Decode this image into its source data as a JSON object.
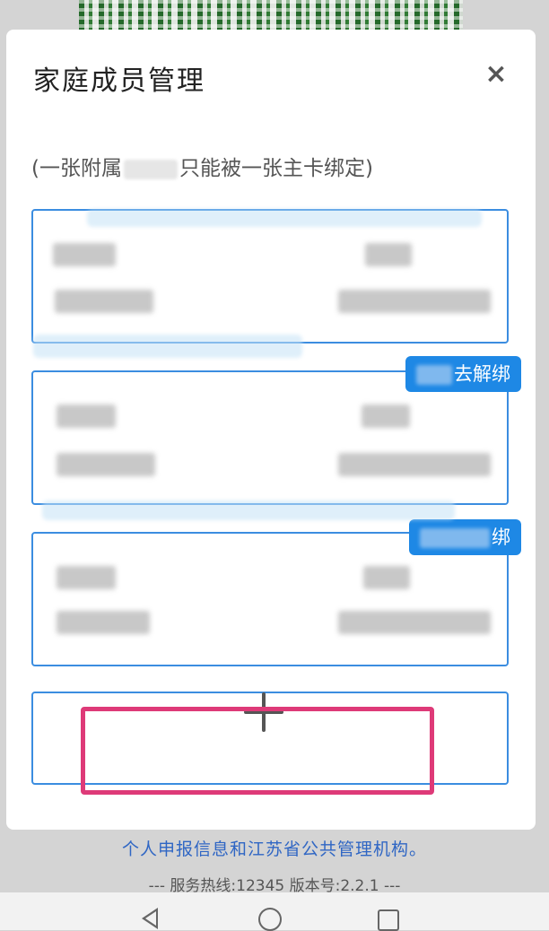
{
  "modal": {
    "title": "家庭成员管理",
    "close_label": "×",
    "note_prefix": "(一张附属",
    "note_suffix": "只能被一张主卡绑定)"
  },
  "cards": [
    {
      "unbind_label": ""
    },
    {
      "unbind_label": "去解绑"
    },
    {
      "unbind_label": "绑"
    }
  ],
  "add_card": {
    "icon": "plus-icon"
  },
  "background": {
    "info_text": "个人申报信息和江苏省公共管理机构。",
    "hotline_text": "--- 服务热线:12345   版本号:2.2.1 ---"
  },
  "colors": {
    "accent": "#1e88e5",
    "card_border": "#3b8de0",
    "highlight": "#de3a78"
  }
}
